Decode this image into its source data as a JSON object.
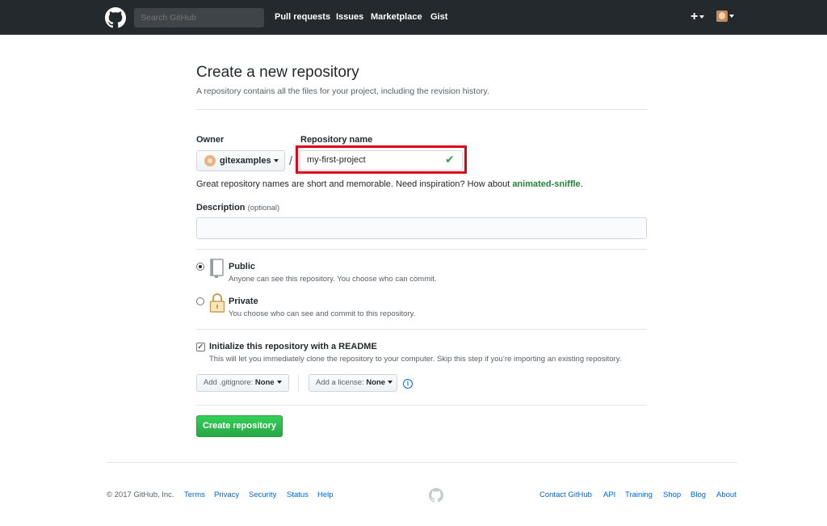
{
  "header": {
    "search_placeholder": "Search GitHub",
    "nav": [
      "Pull requests",
      "Issues",
      "Marketplace",
      "Gist"
    ],
    "plus": "+"
  },
  "main": {
    "title": "Create a new repository",
    "subtitle": "A repository contains all the files for your project, including the revision history.",
    "owner_label": "Owner",
    "owner_value": "gitexamples",
    "repo_label": "Repository name",
    "repo_value": "my-first-project",
    "name_hint": "Great repository names are short and memorable. Need inspiration? How about ",
    "name_suggestion": "animated-sniffle",
    "name_hint_end": ".",
    "description_label": "Description",
    "description_optional": "(optional)",
    "public_title": "Public",
    "public_desc": "Anyone can see this repository. You choose who can commit.",
    "private_title": "Private",
    "private_desc": "You choose who can see and commit to this repository.",
    "readme_title": "Initialize this repository with a README",
    "readme_desc": "This will let you immediately clone the repository to your computer. Skip this step if you’re importing an existing repository.",
    "gitignore_label": "Add .gitignore:",
    "gitignore_value": "None",
    "license_label": "Add a license:",
    "license_value": "None",
    "create_button": "Create repository",
    "selected_visibility": "Public",
    "readme_checked": true
  },
  "footer": {
    "copyright": "© 2017 GitHub, Inc.",
    "left_links": [
      "Terms",
      "Privacy",
      "Security",
      "Status",
      "Help"
    ],
    "right_links": [
      "Contact GitHub",
      "API",
      "Training",
      "Shop",
      "Blog",
      "About"
    ]
  },
  "colors": {
    "header_bg": "#24292e",
    "primary_green": "#28a745",
    "link_blue": "#0366d6",
    "highlight_red": "#e0001a"
  }
}
